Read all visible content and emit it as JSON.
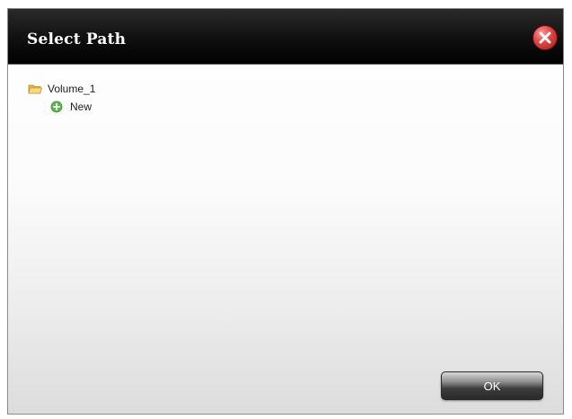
{
  "dialog": {
    "title": "Select Path",
    "close_icon": "close-icon"
  },
  "tree": {
    "root": {
      "label": "Volume_1",
      "icon": "folder-open-icon"
    },
    "children": [
      {
        "label": "New",
        "icon": "add-circle-icon"
      }
    ]
  },
  "footer": {
    "ok_label": "OK"
  },
  "colors": {
    "titlebar": "#101010",
    "close_button": "#d83c3c",
    "folder_icon": "#f3c75a",
    "add_icon": "#5bb84a"
  }
}
